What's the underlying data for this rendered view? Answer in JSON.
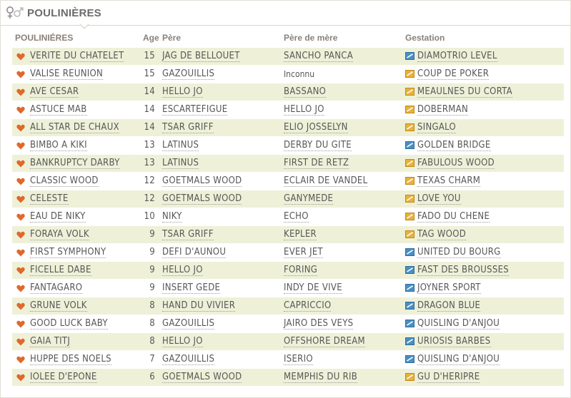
{
  "header": {
    "title": "POULINIÈRES",
    "symbol": "female-male-icon"
  },
  "columns": {
    "name": "POULINIÉRES",
    "age": "Age",
    "pere": "Père",
    "pere_de_mere": "Père de mère",
    "gestation": "Gestation"
  },
  "colors": {
    "heart": "#e0682b",
    "gest_orange": "#e8b23a",
    "gest_blue": "#4a8fc4",
    "row_alt": "#eef1d8"
  },
  "rows": [
    {
      "name": "VERITE DU CHATELET",
      "age": "15",
      "pere": "JAG DE BELLOUET",
      "pere_de_mere": "SANCHO PANCA",
      "gestation": "DIAMOTRIO LEVEL",
      "icon": "blue",
      "pdm_link": true
    },
    {
      "name": "VALISE REUNION",
      "age": "15",
      "pere": "GAZOUILLIS",
      "pere_de_mere": "Inconnu",
      "gestation": "COUP DE POKER",
      "icon": "orange",
      "pdm_link": false
    },
    {
      "name": "AVE CESAR",
      "age": "14",
      "pere": "HELLO JO",
      "pere_de_mere": "BASSANO",
      "gestation": "MEAULNES DU CORTA",
      "icon": "orange",
      "pdm_link": true
    },
    {
      "name": "ASTUCE MAB",
      "age": "14",
      "pere": "ESCARTEFIGUE",
      "pere_de_mere": "HELLO JO",
      "gestation": "DOBERMAN",
      "icon": "orange",
      "pdm_link": true
    },
    {
      "name": "ALL STAR DE CHAUX",
      "age": "14",
      "pere": "TSAR GRIFF",
      "pere_de_mere": "ELIO JOSSELYN",
      "gestation": "SINGALO",
      "icon": "orange",
      "pdm_link": true
    },
    {
      "name": "BIMBO A KIKI",
      "age": "13",
      "pere": "LATINUS",
      "pere_de_mere": "DERBY DU GITE",
      "gestation": "GOLDEN BRIDGE",
      "icon": "blue",
      "pdm_link": true
    },
    {
      "name": "BANKRUPTCY DARBY",
      "age": "13",
      "pere": "LATINUS",
      "pere_de_mere": "FIRST DE RETZ",
      "gestation": "FABULOUS WOOD",
      "icon": "orange",
      "pdm_link": true
    },
    {
      "name": "CLASSIC WOOD",
      "age": "12",
      "pere": "GOETMALS WOOD",
      "pere_de_mere": "ECLAIR DE VANDEL",
      "gestation": "TEXAS CHARM",
      "icon": "orange",
      "pdm_link": true
    },
    {
      "name": "CELESTE",
      "age": "12",
      "pere": "GOETMALS WOOD",
      "pere_de_mere": "GANYMEDE",
      "gestation": "LOVE YOU",
      "icon": "orange",
      "pdm_link": true
    },
    {
      "name": "EAU DE NIKY",
      "age": "10",
      "pere": "NIKY",
      "pere_de_mere": "ECHO",
      "gestation": "FADO DU CHENE",
      "icon": "orange",
      "pdm_link": true
    },
    {
      "name": "FORAYA VOLK",
      "age": "9",
      "pere": "TSAR GRIFF",
      "pere_de_mere": "KEPLER",
      "gestation": "TAG WOOD",
      "icon": "orange",
      "pdm_link": true
    },
    {
      "name": "FIRST SYMPHONY",
      "age": "9",
      "pere": "DEFI D'AUNOU",
      "pere_de_mere": "EVER JET",
      "gestation": "UNITED DU BOURG",
      "icon": "blue",
      "pdm_link": true
    },
    {
      "name": "FICELLE DABE",
      "age": "9",
      "pere": "HELLO JO",
      "pere_de_mere": "FORING",
      "gestation": "FAST DES BROUSSES",
      "icon": "blue",
      "pdm_link": true
    },
    {
      "name": "FANTAGARO",
      "age": "9",
      "pere": "INSERT GEDE",
      "pere_de_mere": "INDY DE VIVE",
      "gestation": "JOYNER SPORT",
      "icon": "blue",
      "pdm_link": true
    },
    {
      "name": "GRUNE VOLK",
      "age": "8",
      "pere": "HAND DU VIVIER",
      "pere_de_mere": "CAPRICCIO",
      "gestation": "DRAGON BLUE",
      "icon": "blue",
      "pdm_link": true
    },
    {
      "name": "GOOD LUCK BABY",
      "age": "8",
      "pere": "GAZOUILLIS",
      "pere_de_mere": "JAIRO DES VEYS",
      "gestation": "QUISLING D'ANJOU",
      "icon": "blue",
      "pdm_link": true
    },
    {
      "name": "GAIA TITJ",
      "age": "8",
      "pere": "HELLO JO",
      "pere_de_mere": "OFFSHORE DREAM",
      "gestation": "URIOSIS BARBES",
      "icon": "blue",
      "pdm_link": true
    },
    {
      "name": "HUPPE DES NOELS",
      "age": "7",
      "pere": "GAZOUILLIS",
      "pere_de_mere": "ISERIO",
      "gestation": "QUISLING D'ANJOU",
      "icon": "blue",
      "pdm_link": true
    },
    {
      "name": "IOLEE D'EPONE",
      "age": "6",
      "pere": "GOETMALS WOOD",
      "pere_de_mere": "MEMPHIS DU RIB",
      "gestation": "GU D'HERIPRE",
      "icon": "orange",
      "pdm_link": true
    }
  ]
}
